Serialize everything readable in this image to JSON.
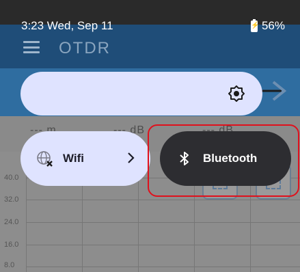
{
  "status_bar": {
    "time_date": "3:23 Wed, Sep 11",
    "battery_percent": "56%",
    "battery_icon": "battery-charging-icon"
  },
  "background_app": {
    "title": "OTDR",
    "readings": [
      "--- m",
      "--- dB",
      "--- dB"
    ],
    "y_ticks": [
      "40.0",
      "32.0",
      "24.0",
      "16.0",
      "8.0"
    ]
  },
  "quick_settings": {
    "brightness": {
      "icon": "brightness-icon"
    },
    "tiles": [
      {
        "label": "Wifi",
        "icon": "wifi-off-icon",
        "state": "off",
        "has_chevron": true
      },
      {
        "label": "Bluetooth",
        "icon": "bluetooth-icon",
        "state": "on"
      }
    ]
  },
  "colors": {
    "tile_off_bg": "#dfe3ff",
    "tile_on_bg": "#2d2d31",
    "highlight": "#e0101c"
  }
}
